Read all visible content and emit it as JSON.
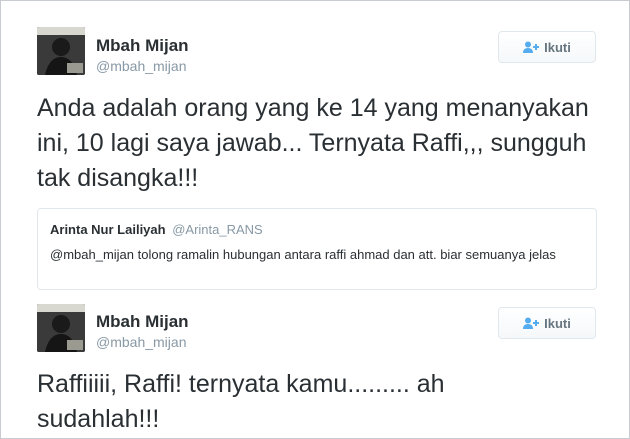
{
  "tweets": [
    {
      "author_name": "Mbah Mijan",
      "author_handle": "@mbah_mijan",
      "follow_label": "Ikuti",
      "text": "Anda adalah orang yang ke 14 yang menanyakan ini, 10 lagi saya jawab... Ternyata Raffi,,, sungguh tak disangka!!!",
      "quoted": {
        "author_name": "Arinta Nur Lailiyah",
        "author_handle": "@Arinta_RANS",
        "text": "@mbah_mijan tolong ramalin hubungan antara raffi ahmad dan att. biar semuanya jelas"
      }
    },
    {
      "author_name": "Mbah Mijan",
      "author_handle": "@mbah_mijan",
      "follow_label": "Ikuti",
      "text": "Raffiiiii, Raffi! ternyata kamu......... ah sudahlah!!!"
    }
  ],
  "colors": {
    "text": "#292f33",
    "secondary": "#8899a6",
    "follow_icon": "#55acee",
    "border": "#e1e8ed"
  },
  "icons": {
    "follow": "person-plus-icon"
  }
}
